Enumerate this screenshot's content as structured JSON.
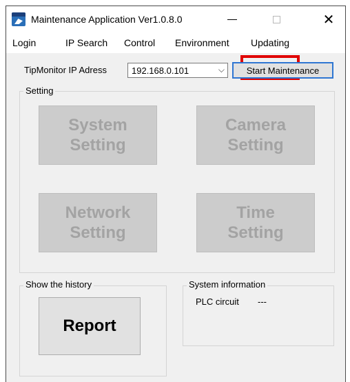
{
  "window": {
    "title": "Maintenance Application Ver1.0.8.0",
    "app_icon": "tool-app-icon",
    "controls": [
      "minimize-icon",
      "maximize-icon",
      "close-icon"
    ],
    "close_glyph": "✕"
  },
  "menu": {
    "login": "Login",
    "ip_search": "IP Search",
    "control": "Control",
    "environment": "Environment",
    "updating": "Updating"
  },
  "highlight_color": "#e00000",
  "connection": {
    "ip_label": "TipMonitor IP Adress",
    "ip_value": "192.168.0.101",
    "start_button": "Start Maintenance",
    "accent_color": "#2e76d2"
  },
  "setting": {
    "label": "Setting",
    "system_line1": "System",
    "system_line2": "Setting",
    "camera_line1": "Camera",
    "camera_line2": "Setting",
    "network_line1": "Network",
    "network_line2": "Setting",
    "time_line1": "Time",
    "time_line2": "Setting"
  },
  "history": {
    "label": "Show the history",
    "report_button": "Report"
  },
  "system_info": {
    "label": "System information",
    "plc_label": "PLC circuit",
    "plc_value": "---"
  }
}
